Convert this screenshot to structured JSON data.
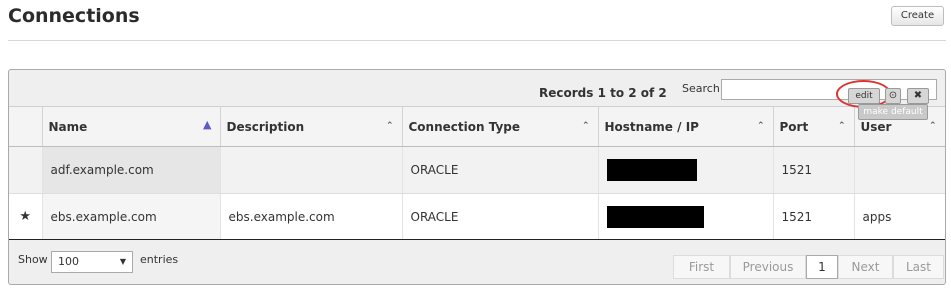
{
  "header": {
    "title": "Connections",
    "create_label": "Create"
  },
  "toolbar": {
    "records_text": "Records 1 to 2 of 2",
    "search_label": "Search:",
    "search_value": ""
  },
  "table": {
    "columns": [
      "Name",
      "Description",
      "Connection Type",
      "Hostname / IP",
      "Port",
      "User"
    ],
    "sorted_column": "Name",
    "rows": [
      {
        "default": false,
        "name": "adf.example.com",
        "description": "",
        "type": "ORACLE",
        "hostname_redacted": true,
        "port": "1521",
        "user": ""
      },
      {
        "default": true,
        "name": "ebs.example.com",
        "description": "ebs.example.com",
        "type": "ORACLE",
        "hostname_redacted": true,
        "port": "1521",
        "user": "apps"
      }
    ]
  },
  "row_actions": {
    "edit_label": "edit",
    "info_symbol": "⊙",
    "delete_symbol": "✖",
    "make_default_label": "make default",
    "highlight_color": "#dd3333"
  },
  "footer": {
    "show_label": "Show",
    "page_size": "100",
    "entries_label": "entries",
    "pagination": [
      "First",
      "Previous",
      "1",
      "Next",
      "Last"
    ],
    "current_page": "1"
  },
  "colors": {
    "panel_bg": "#efefef",
    "sort_active": "#5b5bc9"
  }
}
